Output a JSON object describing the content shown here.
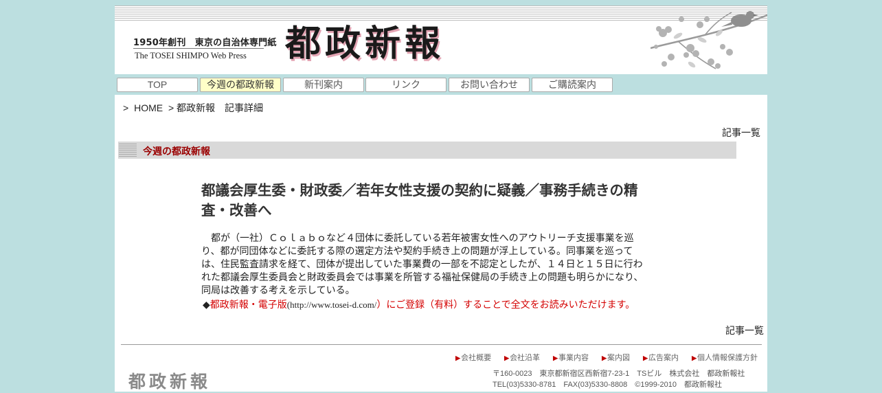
{
  "header": {
    "tagline": "1950年創刊　東京の自治体専門紙",
    "subline": "The TOSEI SHIMPO Web Press",
    "logo": "都政新報"
  },
  "nav": {
    "items": [
      {
        "label": "TOP",
        "active": false
      },
      {
        "label": "今週の都政新報",
        "active": true
      },
      {
        "label": "新刊案内",
        "active": false
      },
      {
        "label": "リンク",
        "active": false
      },
      {
        "label": "お問い合わせ",
        "active": false
      },
      {
        "label": "ご購読案内",
        "active": false
      }
    ]
  },
  "breadcrumb": {
    "sep": ">",
    "home": "HOME",
    "current": "> 都政新報　記事詳細"
  },
  "list_link": "記事一覧",
  "section": {
    "title": "今週の都政新報"
  },
  "article": {
    "title": "都議会厚生委・財政委／若年女性支援の契約に疑義／事務手続きの精査・改善へ",
    "body": "　都が（一社）Ｃｏｌａｂｏなど４団体に委託している若年被害女性へのアウトリーチ支援事業を巡り、都が同団体などに委託する際の選定方法や契約手続き上の問題が浮上している。同事業を巡っては、住民監査請求を経て、団体が提出していた事業費の一部を不認定としたが、１４日と１５日に行われた都議会厚生委員会と財政委員会では事業を所管する福祉保健局の手続き上の問題も明らかになり、同局は改善する考えを示している。",
    "note_diamond": "◆",
    "note_link": "都政新報・電子版",
    "note_url": "(http://www.tosei-d.com/",
    "note_rest": "）にご登録（有料）することで全文をお読みいただけます。"
  },
  "footer": {
    "links": [
      "会社概要",
      "会社沿革",
      "事業内容",
      "案内図",
      "広告案内",
      "個人情報保護方針"
    ],
    "logo": "都政新報",
    "address_line1": "〒160-0023　東京都新宿区西新宿7-23-1　TSビル　株式会社　都政新報社",
    "address_line2": "TEL(03)5330-8781　FAX(03)5330-8808　©1999-2010　都政新報社"
  }
}
